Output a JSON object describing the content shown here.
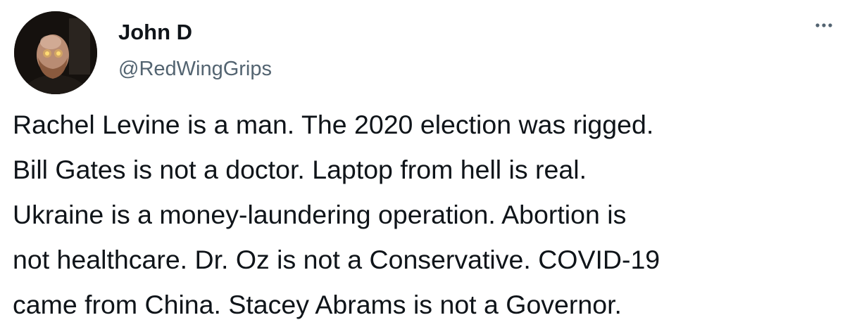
{
  "author": {
    "display_name": "John D",
    "handle": "@RedWingGrips"
  },
  "tweet": {
    "lines": [
      "Rachel Levine is a man. The 2020 election was rigged.",
      "Bill Gates is not a doctor. Laptop from hell is real.",
      "Ukraine is a money-laundering operation. Abortion is",
      "not healthcare. Dr. Oz is not a Conservative. COVID-19",
      "came from China. Stacey Abrams is not a Governor."
    ]
  },
  "icons": {
    "more": "more-horizontal-icon",
    "avatar": "profile-photo"
  },
  "colors": {
    "text": "#0f1419",
    "secondary_text": "#536471",
    "background": "#ffffff"
  }
}
